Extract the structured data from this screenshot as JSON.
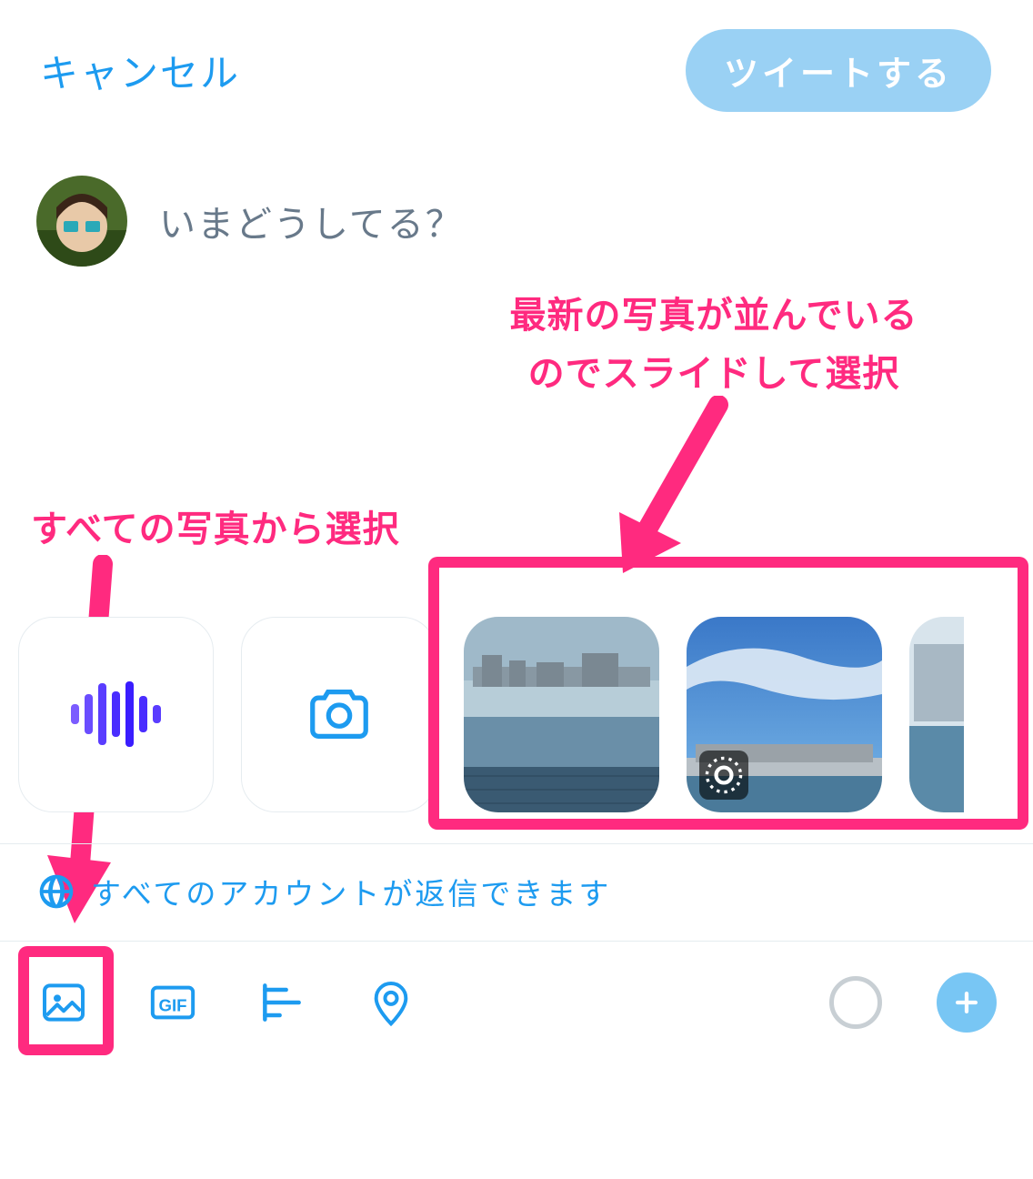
{
  "header": {
    "cancel_label": "キャンセル",
    "tweet_label": "ツイートする"
  },
  "compose": {
    "placeholder": "いまどうしてる？"
  },
  "annotations": {
    "right_line1": "最新の写真が並んでいる",
    "right_line2": "のでスライドして選択",
    "left": "すべての写真から選択"
  },
  "reply": {
    "text": "すべてのアカウントが返信できます"
  },
  "toolbar": {
    "gif_label": "GIF"
  }
}
